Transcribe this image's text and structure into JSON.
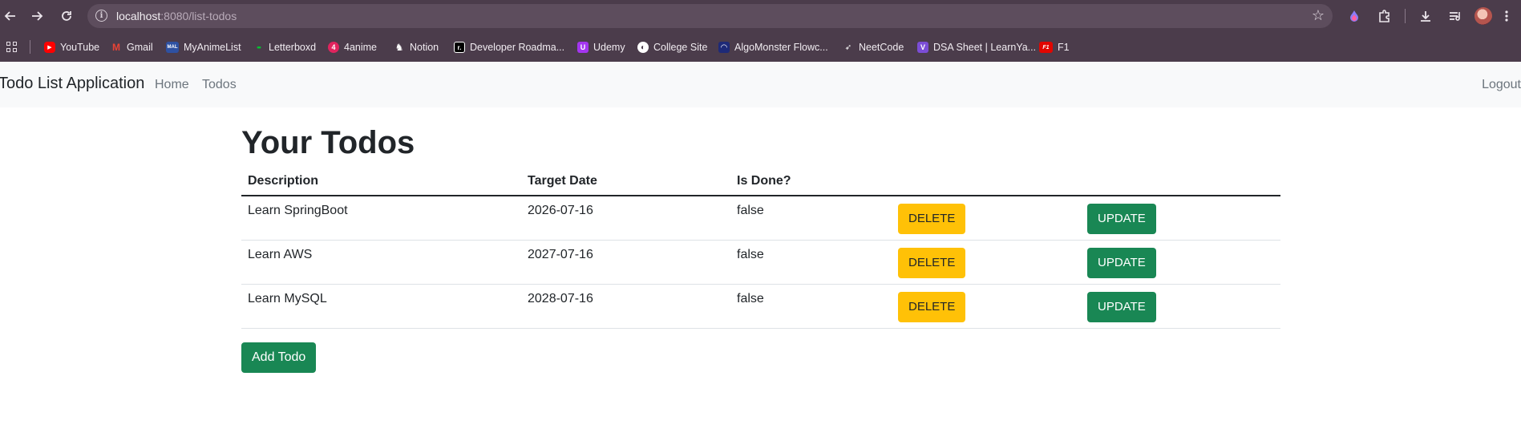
{
  "browser": {
    "url_host": "localhost",
    "url_path": ":8080/list-todos",
    "bookmarks": [
      {
        "label": "YouTube",
        "color": "#ff0000",
        "glyph": "▶"
      },
      {
        "label": "Gmail",
        "color": "#ea4335",
        "glyph": "M"
      },
      {
        "label": "MyAnimeList",
        "color": "#2e51a2",
        "glyph": "MAL"
      },
      {
        "label": "Letterboxd",
        "color": "#00c030",
        "glyph": "•••"
      },
      {
        "label": "4anime",
        "color": "#e0245e",
        "glyph": "4"
      },
      {
        "label": "Notion",
        "color": "#ffffff",
        "glyph": "N"
      },
      {
        "label": "Developer Roadma...",
        "color": "#000000",
        "glyph": "r."
      },
      {
        "label": "Udemy",
        "color": "#a435f0",
        "glyph": "U"
      },
      {
        "label": "College Site",
        "color": "#ffffff",
        "glyph": "◐"
      },
      {
        "label": "AlgoMonster Flowc...",
        "color": "#1e2a78",
        "glyph": "◠"
      },
      {
        "label": "NeetCode",
        "color": "#ffffff",
        "glyph": "🚀"
      },
      {
        "label": "DSA Sheet | LearnYa...",
        "color": "#7b4dd6",
        "glyph": "V"
      },
      {
        "label": "F1",
        "color": "#e10600",
        "glyph": "F1"
      }
    ]
  },
  "navbar": {
    "brand": "Todo List Application",
    "links": [
      "Home",
      "Todos"
    ],
    "logout": "Logout"
  },
  "main": {
    "title": "Your Todos",
    "columns": [
      "Description",
      "Target Date",
      "Is Done?",
      "",
      ""
    ],
    "rows": [
      {
        "description": "Learn SpringBoot",
        "target_date": "2026-07-16",
        "done": "false",
        "delete": "DELETE",
        "update": "UPDATE"
      },
      {
        "description": "Learn AWS",
        "target_date": "2027-07-16",
        "done": "false",
        "delete": "DELETE",
        "update": "UPDATE"
      },
      {
        "description": "Learn MySQL",
        "target_date": "2028-07-16",
        "done": "false",
        "delete": "DELETE",
        "update": "UPDATE"
      }
    ],
    "add_button": "Add Todo"
  },
  "colors": {
    "chrome": "#4b3c4b",
    "navbar_bg": "#f8f9fa",
    "delete_btn": "#ffc107",
    "update_btn": "#198754"
  }
}
